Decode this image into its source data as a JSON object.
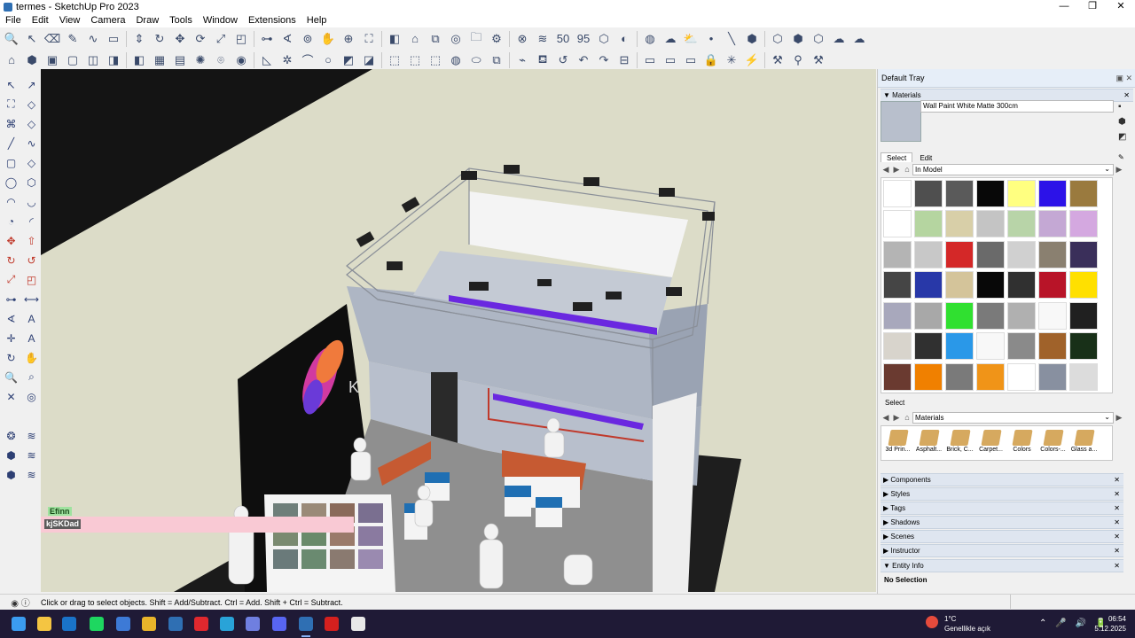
{
  "window": {
    "title": "termes - SketchUp Pro 2023",
    "controls": [
      "—",
      "❐",
      "✕"
    ]
  },
  "menu": [
    "File",
    "Edit",
    "View",
    "Camera",
    "Draw",
    "Tools",
    "Window",
    "Extensions",
    "Help"
  ],
  "toolbar_row1": [
    {
      "icon": "zoom-icon",
      "glyph": "🔍"
    },
    {
      "icon": "select-arrow-icon",
      "glyph": "↖"
    },
    {
      "icon": "eraser-icon",
      "glyph": "⌫"
    },
    {
      "icon": "pencil-line-icon",
      "glyph": "✎"
    },
    {
      "icon": "freehand-icon",
      "glyph": "∿"
    },
    {
      "icon": "rectangle-icon",
      "glyph": "▭"
    },
    {
      "icon": "push-pull-icon",
      "glyph": "⇕"
    },
    {
      "icon": "follow-me-icon",
      "glyph": "↻"
    },
    {
      "icon": "move-icon",
      "glyph": "✥"
    },
    {
      "icon": "rotate-icon",
      "glyph": "⟳"
    },
    {
      "icon": "scale-icon",
      "glyph": "⤢"
    },
    {
      "icon": "offset-icon",
      "glyph": "◰"
    },
    {
      "icon": "tape-measure-icon",
      "glyph": "⊶"
    },
    {
      "icon": "protractor-icon",
      "glyph": "∢"
    },
    {
      "icon": "orbit-icon",
      "glyph": "⊚"
    },
    {
      "icon": "pan-icon",
      "glyph": "✋"
    },
    {
      "icon": "zoom-window-icon",
      "glyph": "⊕"
    },
    {
      "icon": "zoom-extents-icon",
      "glyph": "⛶"
    },
    {
      "icon": "section-plane-icon",
      "glyph": "◧"
    },
    {
      "icon": "warehouse-icon",
      "glyph": "⌂"
    },
    {
      "icon": "extension-icon",
      "glyph": "⧉"
    },
    {
      "icon": "globe-icon",
      "glyph": "◎"
    },
    {
      "icon": "folder-icon",
      "glyph": "🗀"
    },
    {
      "icon": "gear-icon",
      "glyph": "⚙"
    },
    {
      "icon": "close-circle-icon",
      "glyph": "⊗"
    },
    {
      "icon": "layers-icon",
      "glyph": "≋"
    },
    {
      "icon": "number-50-icon",
      "glyph": "50"
    },
    {
      "icon": "number-95-icon",
      "glyph": "95"
    },
    {
      "icon": "hexagon-icon",
      "glyph": "⬡"
    },
    {
      "icon": "half-circle-icon",
      "glyph": "◐"
    },
    {
      "icon": "stripe-circle-icon",
      "glyph": "◍"
    },
    {
      "icon": "cloud-icon",
      "glyph": "☁"
    },
    {
      "icon": "cloud-down-icon",
      "glyph": "⛅"
    },
    {
      "icon": "dot-icon",
      "glyph": "•"
    },
    {
      "icon": "diagonal-line-icon",
      "glyph": "╲"
    },
    {
      "icon": "cube-1-icon",
      "glyph": "⬢"
    },
    {
      "icon": "cube-2-icon",
      "glyph": "⬡"
    },
    {
      "icon": "cube-3-icon",
      "glyph": "⬢"
    },
    {
      "icon": "cube-4-icon",
      "glyph": "⬡"
    },
    {
      "icon": "cloud-sync-icon",
      "glyph": "☁"
    },
    {
      "icon": "cloud-upload-icon",
      "glyph": "☁"
    }
  ],
  "toolbar_row2": [
    {
      "icon": "camera-views-icon",
      "glyph": "⌂"
    },
    {
      "icon": "iso-view-icon",
      "glyph": "⬢"
    },
    {
      "icon": "top-view-icon",
      "glyph": "▣"
    },
    {
      "icon": "front-view-icon",
      "glyph": "▢"
    },
    {
      "icon": "right-view-icon",
      "glyph": "◫"
    },
    {
      "icon": "back-view-icon",
      "glyph": "◨"
    },
    {
      "icon": "left-view-icon",
      "glyph": "◧"
    },
    {
      "icon": "grid-icon",
      "glyph": "▦"
    },
    {
      "icon": "table-icon",
      "glyph": "▤"
    },
    {
      "icon": "solar-icon",
      "glyph": "✺"
    },
    {
      "icon": "lamp-icon",
      "glyph": "⌾"
    },
    {
      "icon": "circle-orange-icon",
      "glyph": "◉"
    },
    {
      "icon": "triangle-ruler-icon",
      "glyph": "◺"
    },
    {
      "icon": "star-icon",
      "glyph": "✲"
    },
    {
      "icon": "arch-icon",
      "glyph": "⌒"
    },
    {
      "icon": "circle-gray-icon",
      "glyph": "○"
    },
    {
      "icon": "xray-icon",
      "glyph": "◩"
    },
    {
      "icon": "shaded-icon",
      "glyph": "◪"
    },
    {
      "icon": "box-1-icon",
      "glyph": "⬚"
    },
    {
      "icon": "box-2-icon",
      "glyph": "⬚"
    },
    {
      "icon": "box-3-icon",
      "glyph": "⬚"
    },
    {
      "icon": "sphere-icon",
      "glyph": "◍"
    },
    {
      "icon": "cylinder-icon",
      "glyph": "⬭"
    },
    {
      "icon": "stack-icon",
      "glyph": "⧉"
    },
    {
      "icon": "brush-icon",
      "glyph": "⌁"
    },
    {
      "icon": "paint-bucket-icon",
      "glyph": "⛾"
    },
    {
      "icon": "refresh-icon",
      "glyph": "↺"
    },
    {
      "icon": "undo-arc-icon",
      "glyph": "↶"
    },
    {
      "icon": "redo-arc-icon",
      "glyph": "↷"
    },
    {
      "icon": "measure-icon",
      "glyph": "⊟"
    },
    {
      "icon": "window-icon",
      "glyph": "▭"
    },
    {
      "icon": "panel-icon",
      "glyph": "▭"
    },
    {
      "icon": "stack-2-icon",
      "glyph": "▭"
    },
    {
      "icon": "lock-icon",
      "glyph": "🔒"
    },
    {
      "icon": "joint-icon",
      "glyph": "✳"
    },
    {
      "icon": "wand-icon",
      "glyph": "⚡"
    },
    {
      "icon": "tools-icon",
      "glyph": "⚒"
    },
    {
      "icon": "pin-icon",
      "glyph": "⚲"
    },
    {
      "icon": "hammer-icon",
      "glyph": "⚒"
    }
  ],
  "left_tools": [
    {
      "icon": "select-tool-icon",
      "glyph": "↖"
    },
    {
      "icon": "lasso-icon",
      "glyph": "↗"
    },
    {
      "icon": "paint-icon",
      "glyph": "⛶"
    },
    {
      "icon": "eraser-tool-icon",
      "glyph": "◇"
    },
    {
      "icon": "component-icon",
      "glyph": "⌘"
    },
    {
      "icon": "tag-eraser-icon",
      "glyph": "◇"
    },
    {
      "icon": "line-tool-icon",
      "glyph": "╱"
    },
    {
      "icon": "freehand-tool-icon",
      "glyph": "∿"
    },
    {
      "icon": "rect-tool-icon",
      "glyph": "▢"
    },
    {
      "icon": "rotated-rect-icon",
      "glyph": "◇"
    },
    {
      "icon": "circle-tool-icon",
      "glyph": "◯"
    },
    {
      "icon": "polygon-tool-icon",
      "glyph": "⬡"
    },
    {
      "icon": "arc-tool-icon",
      "glyph": "◠"
    },
    {
      "icon": "arc2-tool-icon",
      "glyph": "◡"
    },
    {
      "icon": "pie-tool-icon",
      "glyph": "◔"
    },
    {
      "icon": "arc3-tool-icon",
      "glyph": "◜"
    },
    {
      "icon": "move-tool-icon",
      "glyph": "✥"
    },
    {
      "icon": "pushpull-tool-icon",
      "glyph": "⇧"
    },
    {
      "icon": "rotate-tool-icon",
      "glyph": "↻"
    },
    {
      "icon": "followme-tool-icon",
      "glyph": "↺"
    },
    {
      "icon": "scale-tool-icon",
      "glyph": "⤢"
    },
    {
      "icon": "offset-tool-icon",
      "glyph": "◰"
    },
    {
      "icon": "tape-tool-icon",
      "glyph": "⊶"
    },
    {
      "icon": "dimension-tool-icon",
      "glyph": "⟷"
    },
    {
      "icon": "protractor-tool-icon",
      "glyph": "∢"
    },
    {
      "icon": "text-tool-icon",
      "glyph": "A"
    },
    {
      "icon": "axes-tool-icon",
      "glyph": "✛"
    },
    {
      "icon": "3dtext-tool-icon",
      "glyph": "A"
    },
    {
      "icon": "orbit-tool-icon",
      "glyph": "↻"
    },
    {
      "icon": "pan-tool-icon",
      "glyph": "✋"
    },
    {
      "icon": "zoom-tool-icon",
      "glyph": "🔍"
    },
    {
      "icon": "zoom-window-tool-icon",
      "glyph": "⌕"
    },
    {
      "icon": "zoom-extents-tool-icon",
      "glyph": "✕"
    },
    {
      "icon": "previous-view-icon",
      "glyph": "◎"
    },
    {
      "icon": "walk-tool-icon",
      "glyph": ""
    },
    {
      "icon": "lookaround-tool-icon",
      "glyph": ""
    },
    {
      "icon": "section-tool-icon",
      "glyph": "❂"
    },
    {
      "icon": "section-display-icon",
      "glyph": "≋"
    },
    {
      "icon": "section-cut-icon",
      "glyph": "⬢"
    },
    {
      "icon": "section-fill-icon",
      "glyph": "≋"
    },
    {
      "icon": "outliner-icon",
      "glyph": "⬢"
    },
    {
      "icon": "sandbox-icon",
      "glyph": "≋"
    }
  ],
  "viewport": {
    "booth_lettering": "K",
    "plugin_label": "Efinn",
    "vcb_label": "kjSKDad",
    "colors": {
      "sky": "#dcdcc8",
      "black_floor": "#141414",
      "wall": "#b8bfcc",
      "truss": "#d8dde6",
      "purple": "#6a28e0",
      "orange": "#c65a32",
      "blue": "#1f6fb3",
      "carpet": "#8f8f8f"
    }
  },
  "tray": {
    "title": "Default Tray",
    "materials": {
      "panel": "Materials",
      "name": "Wall Paint White Matte 300cm",
      "tabs": [
        "Select",
        "Edit"
      ],
      "collection": "In Model",
      "swatches": [
        "#ffffff",
        "#4f4f4f",
        "#5a5a5a",
        "#080808",
        "#ffff80",
        "#2c12e8",
        "#9a7a3e",
        "#ffffff",
        "#b5d5a0",
        "#d8cfa8",
        "#c4c4c4",
        "#b8d4a8",
        "#c4a8d4",
        "#d4a8e0",
        "#b4b4b4",
        "#c8c8c8",
        "#d42828",
        "#6a6a6a",
        "#d0d0d0",
        "#8a8070",
        "#3a2f5a",
        "#454545",
        "#2838a8",
        "#d4c49a",
        "#080808",
        "#303030",
        "#b81428",
        "#ffe000",
        "#a8a8bc",
        "#a8a8a8",
        "#30e030",
        "#7a7a7a",
        "#b0b0b0",
        "#f8f8f8",
        "#202020",
        "#d8d4cc",
        "#303030",
        "#2a98e8",
        "#f8f8f8",
        "#8a8a8a",
        "#a0622a",
        "#183018",
        "#6a3a30",
        "#f08000",
        "#7a7a7a",
        "#f09418",
        "#ffffff",
        "#8890a0",
        "#dcdcdc"
      ],
      "library_label": "Select",
      "library_collection": "Materials",
      "library_items": [
        "3d Prin...",
        "Asphalt...",
        "Brick, C...",
        "Carpet...",
        "Colors",
        "Colors-...",
        "Glass a..."
      ]
    },
    "collapsed_panels": [
      "Components",
      "Styles",
      "Tags",
      "Shadows",
      "Scenes",
      "Instructor"
    ],
    "entity_info": {
      "panel": "Entity Info",
      "status": "No Selection"
    }
  },
  "statusbar": {
    "text": "Click or drag to select objects. Shift = Add/Subtract. Ctrl = Add. Shift + Ctrl = Subtract."
  },
  "taskbar": {
    "apps": [
      {
        "name": "windows-start-icon",
        "color": "#3b9cf0"
      },
      {
        "name": "file-explorer-icon",
        "color": "#f4c542"
      },
      {
        "name": "outlook-icon",
        "color": "#1a73c8"
      },
      {
        "name": "spotify-icon",
        "color": "#1ed760"
      },
      {
        "name": "sketchup-icon-1",
        "color": "#3d7ad6"
      },
      {
        "name": "chrome-icon",
        "color": "#e9b52a"
      },
      {
        "name": "sketchup-icon-2",
        "color": "#2f6fb3"
      },
      {
        "name": "opera-icon",
        "color": "#e0282e"
      },
      {
        "name": "edge-icon",
        "color": "#29a3d8"
      },
      {
        "name": "app-purple-icon",
        "color": "#6f7fe0"
      },
      {
        "name": "discord-icon",
        "color": "#5865f2"
      },
      {
        "name": "sketchup-active-icon",
        "color": "#2f6fb3"
      },
      {
        "name": "acrobat-icon",
        "color": "#d4201e"
      },
      {
        "name": "github-desktop-icon",
        "color": "#e8e8e8"
      }
    ],
    "weather_temp": "1°C",
    "weather_desc": "Genellikle açık",
    "time": "06:54",
    "date": "5.12.2025"
  }
}
